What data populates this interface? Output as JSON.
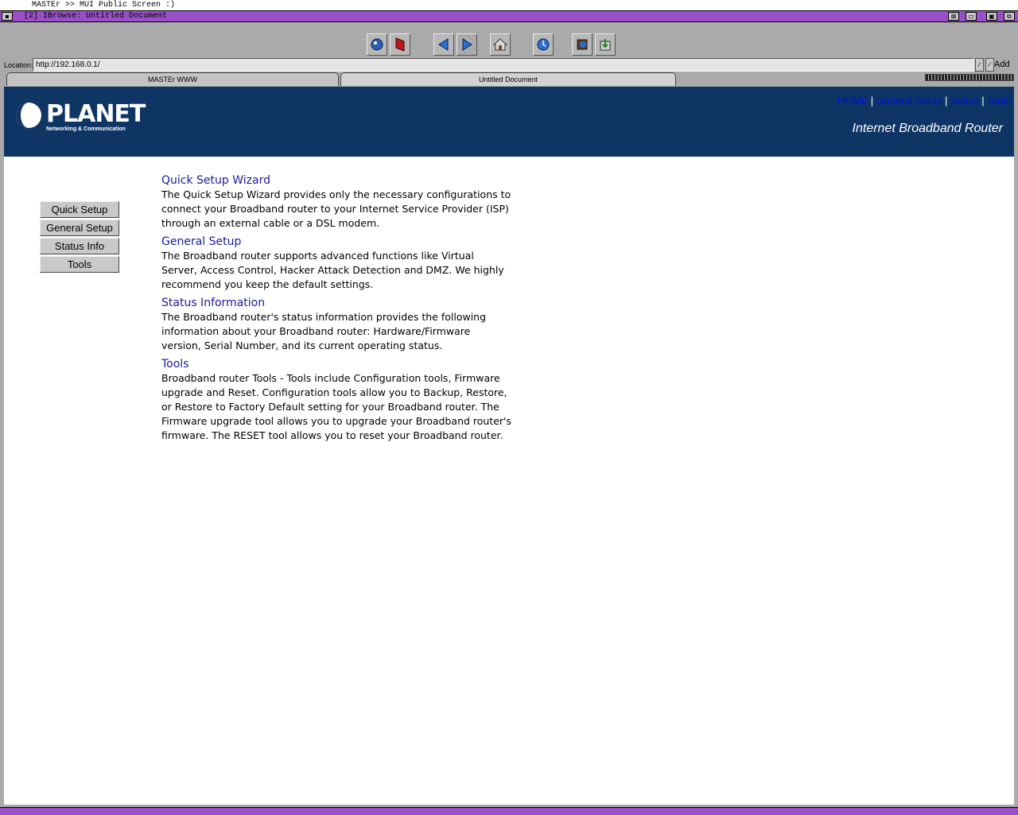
{
  "screen": {
    "title": "MASTEr >> MUI Public Screen :)"
  },
  "window": {
    "title": "[2] IBrowse: Untitled Document"
  },
  "toolbar": {
    "buttons": [
      {
        "name": "ibrowse-icon"
      },
      {
        "name": "stop-icon"
      },
      {
        "name": "back-icon"
      },
      {
        "name": "forward-icon"
      },
      {
        "name": "home-icon"
      },
      {
        "name": "reload-icon"
      },
      {
        "name": "load-images-icon"
      },
      {
        "name": "download-icon"
      }
    ]
  },
  "location": {
    "label": "Location:",
    "url": "http://192.168.0.1/",
    "add_label": "Add"
  },
  "tabs": [
    {
      "label": "MASTEr WWW"
    },
    {
      "label": "Untitled Document"
    }
  ],
  "page": {
    "brand": {
      "name": "PLANET",
      "tagline": "Networking & Communication"
    },
    "topnav": {
      "home": "HOME",
      "general": "General Setup",
      "status": "Status",
      "tools": "Tools",
      "separator": "|"
    },
    "router_title": "Internet Broadband Router",
    "side_buttons": [
      {
        "label": "Quick Setup"
      },
      {
        "label": "General Setup"
      },
      {
        "label": "Status Info"
      },
      {
        "label": "Tools"
      }
    ],
    "sections": [
      {
        "title": "Quick Setup Wizard",
        "text": "The Quick Setup Wizard provides only the necessary configurations to connect your Broadband router to your Internet Service Provider (ISP) through an external cable or a DSL modem."
      },
      {
        "title": "General Setup",
        "text": "The Broadband router supports advanced functions like Virtual Server, Access Control, Hacker Attack Detection and DMZ. We highly recommend you keep the default settings."
      },
      {
        "title": "Status Information",
        "text": "The Broadband router's status information provides the following information about your Broadband router: Hardware/Firmware version, Serial Number, and its current operating status."
      },
      {
        "title": "Tools",
        "text": "Broadband router Tools - Tools include Configuration tools, Firmware upgrade and Reset. Configuration tools allow you to Backup, Restore, or Restore to Factory Default setting for your Broadband router. The Firmware upgrade tool allows you to upgrade your Broadband router's firmware. The RESET tool allows you to reset your Broadband router."
      }
    ]
  },
  "colors": {
    "header_bg": "#0f3565",
    "titlebar": "#9a4fc9",
    "link": "#1a1a99",
    "nav_link": "#0010d8"
  }
}
